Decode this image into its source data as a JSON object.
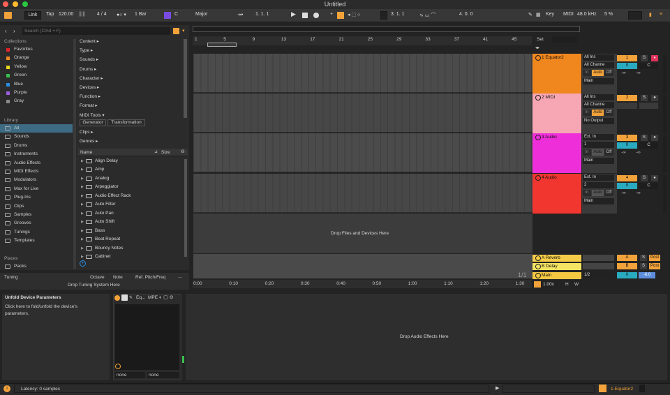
{
  "window": {
    "title": "Untitled"
  },
  "control": {
    "link": "Link",
    "tap": "Tap",
    "tempo": "120.00",
    "sig": "4 / 4",
    "quant": "1 Bar",
    "key": "C",
    "scale": "Major",
    "pos1": "1.   1.   1",
    "pos2": "3.   1.   1",
    "pos3": "4.   0.   0",
    "key_label": "Key",
    "midi_label": "MIDI",
    "sr": "48.0 kHz",
    "cpu": "5 %"
  },
  "browser": {
    "search_placeholder": "Search (Cmd + F)",
    "collections_title": "Collections",
    "collections": [
      {
        "label": "Favorites",
        "color": "#e0252b"
      },
      {
        "label": "Orange",
        "color": "#f08a21"
      },
      {
        "label": "Yellow",
        "color": "#e6d51e"
      },
      {
        "label": "Green",
        "color": "#37c24a"
      },
      {
        "label": "Blue",
        "color": "#2a8de0"
      },
      {
        "label": "Purple",
        "color": "#9a5ee0"
      },
      {
        "label": "Gray",
        "color": "#8a8a8a"
      }
    ],
    "library_title": "Library",
    "library": [
      "All",
      "Sounds",
      "Drums",
      "Instruments",
      "Audio Effects",
      "MIDI Effects",
      "Modulators",
      "Max for Live",
      "Plug-Ins",
      "Clips",
      "Samples",
      "Grooves",
      "Tunings",
      "Templates"
    ],
    "places_title": "Places",
    "places": [
      "Packs"
    ],
    "filters": [
      "Content ▸",
      "Type ▸",
      "Sounds ▸",
      "Drums ▸",
      "Character ▸",
      "Devices ▸",
      "Function ▸",
      "Format ▸",
      "MIDI Tools ▾"
    ],
    "tags": [
      "Generator",
      "Transformation"
    ],
    "filters2": [
      "Clips ▸",
      "Genres ▸"
    ],
    "col_name": "Name",
    "col_size": "Size",
    "items": [
      "Align Delay",
      "Amp",
      "Analog",
      "Arpeggiator",
      "Audio Effect Rack",
      "Auto Filter",
      "Auto Pan",
      "Auto Shift",
      "Bass",
      "Beat Repeat",
      "Bouncy Notes",
      "Cabinet"
    ]
  },
  "tuning": {
    "title": "Tuning",
    "octave": "Octave",
    "note": "Note",
    "ref": "Ref. Pitch/Freq",
    "more": "...",
    "drop": "Drop Tuning System Here"
  },
  "arrangement": {
    "bars": [
      "1",
      "5",
      "9",
      "13",
      "17",
      "21",
      "25",
      "29",
      "33",
      "37",
      "41",
      "45"
    ],
    "times": [
      "0:00",
      "0:10",
      "0:20",
      "0:30",
      "0:40",
      "0:50",
      "1:00",
      "1:10",
      "1:20",
      "1:30"
    ],
    "drop": "Drop Files and Devices Here",
    "set": "Set",
    "page": "1/1",
    "zoom": "1.00x",
    "h": "H",
    "w": "W"
  },
  "tracks": [
    {
      "name": "1 Equator2",
      "color": "#f0861e",
      "in": "All Ins",
      "ch": "All Channe",
      "mon": "Auto",
      "out": "Main",
      "num": "1",
      "vol": "0",
      "pan": "C",
      "l": "-∞",
      "r": "-∞",
      "ht": 57
    },
    {
      "name": "2 MIDI",
      "color": "#f7a6b4",
      "in": "All Ins",
      "ch": "All Channe",
      "mon": "Auto",
      "out": "No Output",
      "num": "2",
      "vol": "",
      "pan": "",
      "l": "",
      "r": "",
      "ht": 57
    },
    {
      "name": "3 Audio",
      "color": "#ee2ed8",
      "in": "Ext. In",
      "ch": "1",
      "mon": "Auto",
      "out": "Main",
      "num": "3",
      "vol": "0",
      "pan": "C",
      "l": "-∞",
      "r": "-∞",
      "ht": 57
    },
    {
      "name": "4 Audio",
      "color": "#f0362f",
      "in": "Ext. In",
      "ch": "2",
      "mon": "Auto",
      "out": "Main",
      "num": "4",
      "vol": "0",
      "pan": "C",
      "l": "-∞",
      "r": "-∞",
      "ht": 57
    }
  ],
  "returns": [
    {
      "name": "A Reverb",
      "color": "#f5cc48",
      "letter": "A",
      "post": "Post"
    },
    {
      "name": "B Delay",
      "color": "#f5e462",
      "letter": "B",
      "post": "Post"
    }
  ],
  "main": {
    "name": "Main",
    "color": "#f5c842",
    "cue": "1/2",
    "vol": "0",
    "db": "-6.0"
  },
  "mixbtn": {
    "s": "S",
    "in": "In",
    "off": "Off"
  },
  "detail": {
    "info_title": "Unfold Device Parameters",
    "info_text": "Click here to fold/unfold the device's parameters.",
    "device_title": "Eq...",
    "mpe": "MPE",
    "sel1": "none",
    "sel2": "none",
    "drop": "Drop Audio Effects Here"
  },
  "status": {
    "text": "Latency: 0 samples",
    "track": "1-Equator2"
  }
}
